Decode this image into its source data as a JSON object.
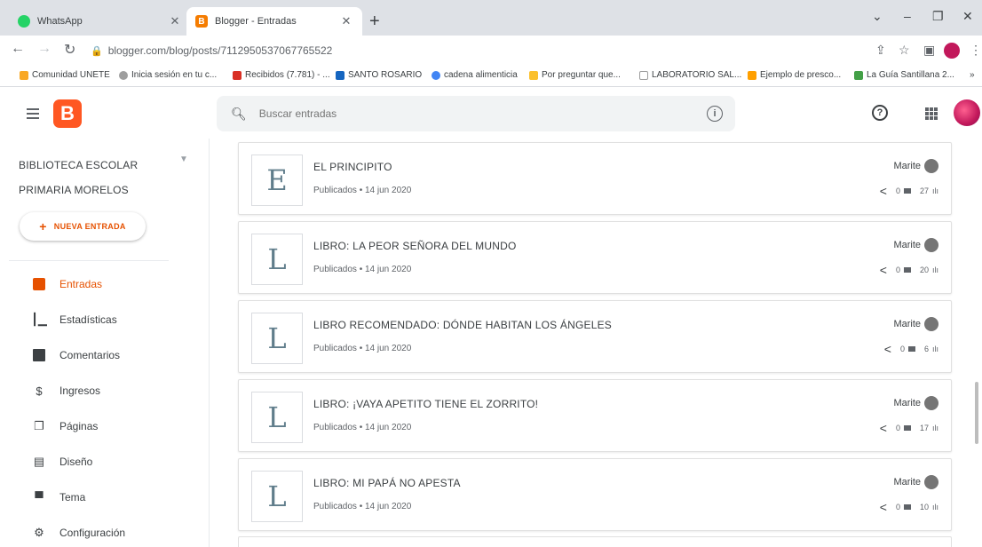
{
  "browser": {
    "tabs": [
      {
        "title": "WhatsApp",
        "icon": "whatsapp-icon"
      },
      {
        "title": "Blogger - Entradas",
        "icon": "blogger-icon"
      }
    ],
    "url": "blogger.com/blog/posts/7112950537067765522",
    "bookmarks": [
      "Comunidad UNETE",
      "Inicia sesión en tu c...",
      "Recibidos (7.781) - ...",
      "SANTO ROSARIO",
      "cadena alimenticia",
      "Por preguntar que...",
      "LABORATORIO SAL...",
      "Ejemplo de presco...",
      "La Guía Santillana 2..."
    ]
  },
  "header": {
    "logo": "B",
    "search_placeholder": "Buscar entradas"
  },
  "sidebar": {
    "blog_name": "BIBLIOTECA ESCOLAR PRIMARIA MORELOS",
    "new_post_label": "NUEVA ENTRADA",
    "items": [
      {
        "label": "Entradas",
        "icon": "posts-icon",
        "active": true
      },
      {
        "label": "Estadísticas",
        "icon": "stats-icon",
        "active": false
      },
      {
        "label": "Comentarios",
        "icon": "comments-icon",
        "active": false
      },
      {
        "label": "Ingresos",
        "icon": "dollar-icon",
        "active": false
      },
      {
        "label": "Páginas",
        "icon": "pages-icon",
        "active": false
      },
      {
        "label": "Diseño",
        "icon": "layout-icon",
        "active": false
      },
      {
        "label": "Tema",
        "icon": "paint-roller-icon",
        "active": false
      },
      {
        "label": "Configuración",
        "icon": "gear-icon",
        "active": false
      }
    ]
  },
  "posts": [
    {
      "letter": "E",
      "title": "EL PRINCIPITO",
      "status": "Publicados • 14 jun 2020",
      "author": "Marite",
      "comments": "0",
      "views": "27"
    },
    {
      "letter": "L",
      "title": "LIBRO: LA PEOR SEÑORA DEL MUNDO",
      "status": "Publicados • 14 jun 2020",
      "author": "Marite",
      "comments": "0",
      "views": "20"
    },
    {
      "letter": "L",
      "title": "LIBRO RECOMENDADO: DÓNDE HABITAN LOS ÁNGELES",
      "status": "Publicados • 14 jun 2020",
      "author": "Marite",
      "comments": "0",
      "views": "6"
    },
    {
      "letter": "L",
      "title": "LIBRO: ¡VAYA APETITO TIENE EL ZORRITO!",
      "status": "Publicados • 14 jun 2020",
      "author": "Marite",
      "comments": "0",
      "views": "17"
    },
    {
      "letter": "L",
      "title": "LIBRO: MI PAPÁ NO APESTA",
      "status": "Publicados • 14 jun 2020",
      "author": "Marite",
      "comments": "0",
      "views": "10"
    }
  ],
  "colors": {
    "accent": "#e65100",
    "blogger_orange": "#ff5722",
    "tabstrip": "#dee1e6"
  }
}
